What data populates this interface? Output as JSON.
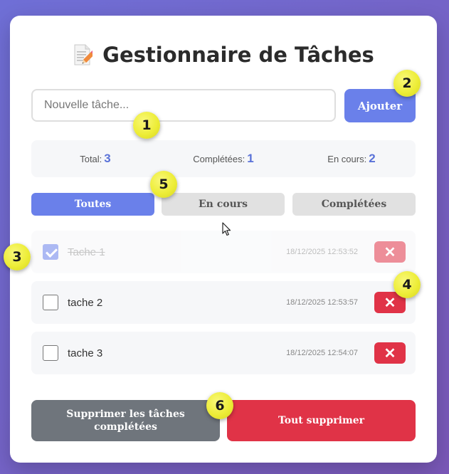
{
  "header": {
    "icon": "memo-icon",
    "title": "Gestionnaire de Tâches"
  },
  "input": {
    "placeholder": "Nouvelle tâche...",
    "value": "",
    "add_label": "Ajouter"
  },
  "stats": {
    "total_label": "Total:",
    "total_value": "3",
    "completed_label": "Complétées:",
    "completed_value": "1",
    "in_progress_label": "En cours:",
    "in_progress_value": "2"
  },
  "filters": [
    {
      "label": "Toutes",
      "active": true
    },
    {
      "label": "En cours",
      "active": false
    },
    {
      "label": "Complétées",
      "active": false
    }
  ],
  "tasks": [
    {
      "text": "Tache 1",
      "date": "18/12/2025 12:53:52",
      "completed": true,
      "delete_icon": "close-icon"
    },
    {
      "text": "tache 2",
      "date": "18/12/2025 12:53:57",
      "completed": false,
      "delete_icon": "close-icon"
    },
    {
      "text": "tache 3",
      "date": "18/12/2025 12:54:07",
      "completed": false,
      "delete_icon": "close-icon"
    }
  ],
  "actions": {
    "clear_completed_label": "Supprimer les tâches complétées",
    "clear_all_label": "Tout supprimer"
  },
  "annotations": [
    "1",
    "2",
    "3",
    "4",
    "5",
    "6"
  ],
  "colors": {
    "accent": "#6a80ea",
    "danger": "#e03347",
    "secondary": "#6f757c",
    "badge": "#eded38"
  }
}
